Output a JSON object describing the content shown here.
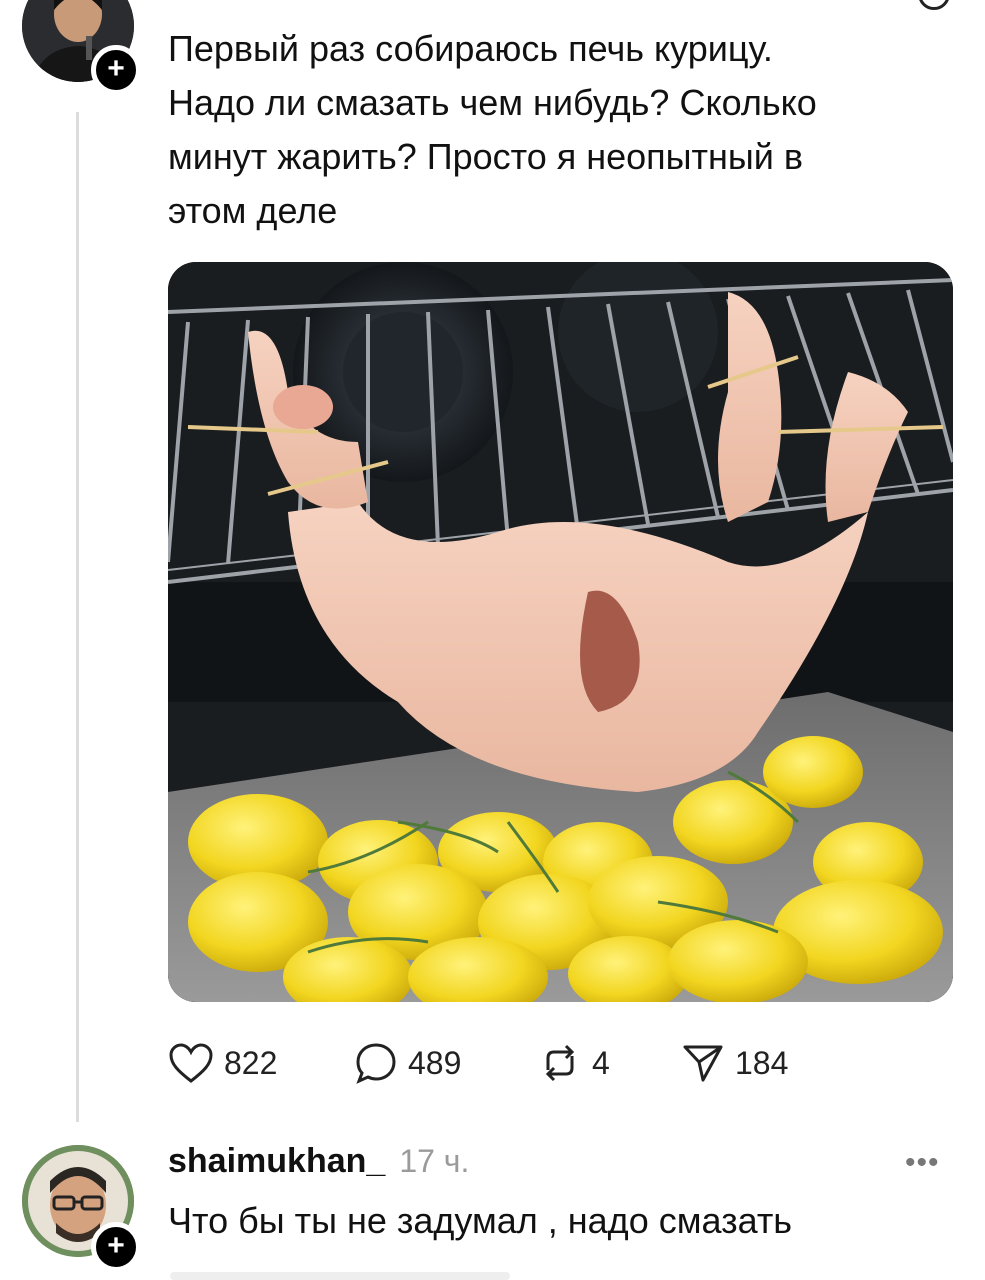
{
  "post": {
    "text_lines": [
      "Первый раз собираюсь печь курицу.",
      "Надо ли смазать чем нибудь? Сколько",
      "минут жарить? Просто я неопытный в",
      "этом деле"
    ],
    "stats": {
      "likes": "822",
      "replies": "489",
      "reposts": "4",
      "shares": "184"
    }
  },
  "reply": {
    "username": "shaimukhan_",
    "time": "17 ч.",
    "text": "Что бы ты не задумал , надо смазать",
    "more": "•••"
  },
  "icons": {
    "like": "heart-icon",
    "reply": "comment-icon",
    "repost": "repost-icon",
    "share": "send-icon",
    "follow": "plus-icon"
  },
  "colors": {
    "text": "#111111",
    "muted": "#9a9a9a",
    "thread_line": "#dcdcdc"
  }
}
